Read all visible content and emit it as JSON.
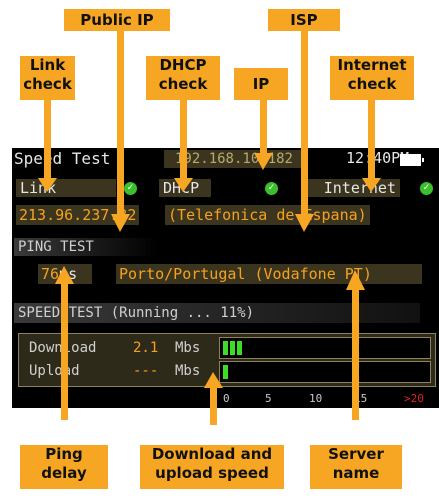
{
  "device": {
    "title": "Speed Test",
    "ip": "192.168.10.182",
    "clock": "12:40PM",
    "link_label": "Link",
    "dhcp_label": "DHCP",
    "internet_label": "Internet",
    "public_ip": "213.96.237.32",
    "isp": "(Telefonica de Espana)",
    "ping_header": "PING TEST",
    "ping_value": "76",
    "ping_unit": "ms",
    "server": "Porto/Portugal (Vodafone PT)",
    "speed_header": "SPEED TEST (Running ...  11%)",
    "download_label": "Download",
    "download_value": "2.1",
    "download_unit": "Mbs",
    "upload_label": "Upload",
    "upload_value": "---",
    "upload_unit": "Mbs",
    "download_level_mbs": 2.1,
    "upload_level_mbs": 0.1,
    "scale": [
      "0",
      "5",
      "10",
      "15",
      ">20"
    ],
    "colors": {
      "accent": "#f4a21e",
      "check": "#3cbf2c",
      "callout": "#f6a623",
      "scale_max": "#e02020"
    }
  },
  "callouts": {
    "public_ip": "Public IP",
    "isp": "ISP",
    "link": "Link\ncheck",
    "dhcp": "DHCP\ncheck",
    "ip": "IP",
    "internet": "Internet\ncheck",
    "ping": "Ping\ndelay",
    "speed": "Download and\nupload speed",
    "server": "Server\nname"
  }
}
